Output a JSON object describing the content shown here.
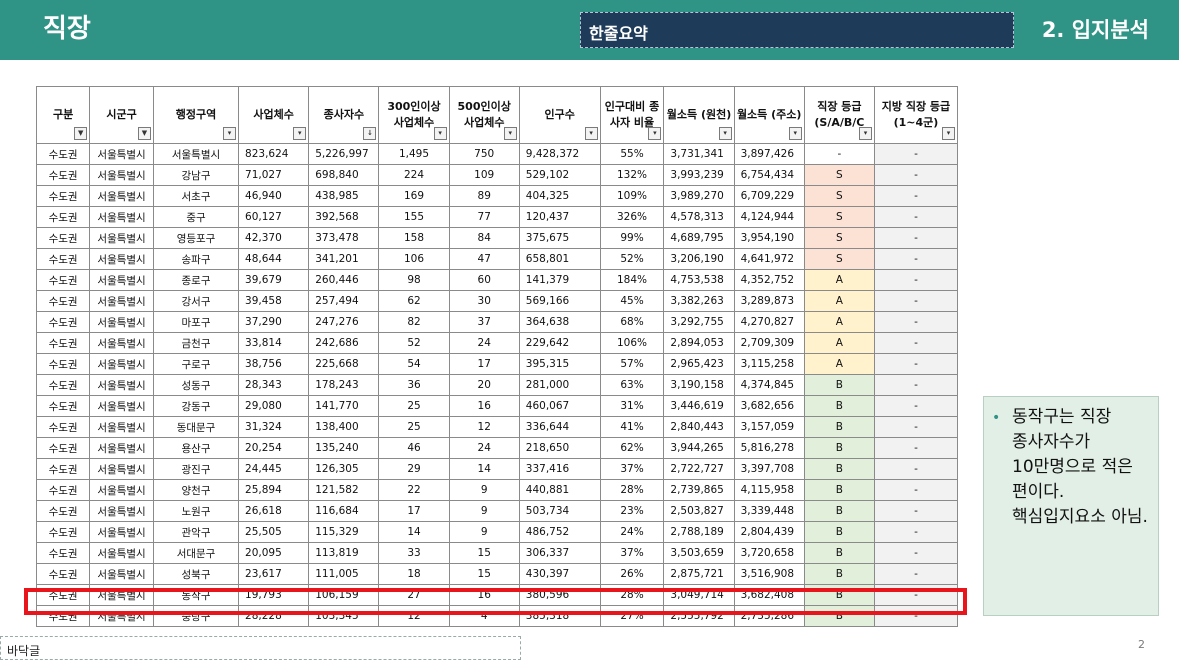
{
  "header": {
    "left_title": "직장",
    "summary_label": "한줄요약",
    "right_title": "2. 입지분석"
  },
  "table": {
    "columns": [
      {
        "label": "구분",
        "filter": "funnel"
      },
      {
        "label": "시군구",
        "filter": "funnel"
      },
      {
        "label": "행정구역",
        "filter": "dropdown"
      },
      {
        "label": "사업체수",
        "filter": "dropdown"
      },
      {
        "label": "종사자수",
        "filter": "sort-desc"
      },
      {
        "label": "300인이상 사업체수",
        "filter": "dropdown"
      },
      {
        "label": "500인이상 사업체수",
        "filter": "dropdown"
      },
      {
        "label": "인구수",
        "filter": "dropdown"
      },
      {
        "label": "인구대비 종사자 비율",
        "filter": "dropdown"
      },
      {
        "label": "월소득 (원천)",
        "filter": "dropdown"
      },
      {
        "label": "월소득 (주소)",
        "filter": "dropdown"
      },
      {
        "label": "직장 등급 (S/A/B/C",
        "filter": "dropdown"
      },
      {
        "label": "지방 직장 등급 (1~4군)",
        "filter": "dropdown"
      }
    ],
    "rows": [
      [
        "수도권",
        "서울특별시",
        "서울특별시",
        "823,624",
        "5,226,997",
        "1,495",
        "750",
        "9,428,372",
        "55%",
        "3,731,341",
        "3,897,426",
        "-",
        "-"
      ],
      [
        "수도권",
        "서울특별시",
        "강남구",
        "71,027",
        "698,840",
        "224",
        "109",
        "529,102",
        "132%",
        "3,993,239",
        "6,754,434",
        "S",
        "-"
      ],
      [
        "수도권",
        "서울특별시",
        "서초구",
        "46,940",
        "438,985",
        "169",
        "89",
        "404,325",
        "109%",
        "3,989,270",
        "6,709,229",
        "S",
        "-"
      ],
      [
        "수도권",
        "서울특별시",
        "중구",
        "60,127",
        "392,568",
        "155",
        "77",
        "120,437",
        "326%",
        "4,578,313",
        "4,124,944",
        "S",
        "-"
      ],
      [
        "수도권",
        "서울특별시",
        "영등포구",
        "42,370",
        "373,478",
        "158",
        "84",
        "375,675",
        "99%",
        "4,689,795",
        "3,954,190",
        "S",
        "-"
      ],
      [
        "수도권",
        "서울특별시",
        "송파구",
        "48,644",
        "341,201",
        "106",
        "47",
        "658,801",
        "52%",
        "3,206,190",
        "4,641,972",
        "S",
        "-"
      ],
      [
        "수도권",
        "서울특별시",
        "종로구",
        "39,679",
        "260,446",
        "98",
        "60",
        "141,379",
        "184%",
        "4,753,538",
        "4,352,752",
        "A",
        "-"
      ],
      [
        "수도권",
        "서울특별시",
        "강서구",
        "39,458",
        "257,494",
        "62",
        "30",
        "569,166",
        "45%",
        "3,382,263",
        "3,289,873",
        "A",
        "-"
      ],
      [
        "수도권",
        "서울특별시",
        "마포구",
        "37,290",
        "247,276",
        "82",
        "37",
        "364,638",
        "68%",
        "3,292,755",
        "4,270,827",
        "A",
        "-"
      ],
      [
        "수도권",
        "서울특별시",
        "금천구",
        "33,814",
        "242,686",
        "52",
        "24",
        "229,642",
        "106%",
        "2,894,053",
        "2,709,309",
        "A",
        "-"
      ],
      [
        "수도권",
        "서울특별시",
        "구로구",
        "38,756",
        "225,668",
        "54",
        "17",
        "395,315",
        "57%",
        "2,965,423",
        "3,115,258",
        "A",
        "-"
      ],
      [
        "수도권",
        "서울특별시",
        "성동구",
        "28,343",
        "178,243",
        "36",
        "20",
        "281,000",
        "63%",
        "3,190,158",
        "4,374,845",
        "B",
        "-"
      ],
      [
        "수도권",
        "서울특별시",
        "강동구",
        "29,080",
        "141,770",
        "25",
        "16",
        "460,067",
        "31%",
        "3,446,619",
        "3,682,656",
        "B",
        "-"
      ],
      [
        "수도권",
        "서울특별시",
        "동대문구",
        "31,324",
        "138,400",
        "25",
        "12",
        "336,644",
        "41%",
        "2,840,443",
        "3,157,059",
        "B",
        "-"
      ],
      [
        "수도권",
        "서울특별시",
        "용산구",
        "20,254",
        "135,240",
        "46",
        "24",
        "218,650",
        "62%",
        "3,944,265",
        "5,816,278",
        "B",
        "-"
      ],
      [
        "수도권",
        "서울특별시",
        "광진구",
        "24,445",
        "126,305",
        "29",
        "14",
        "337,416",
        "37%",
        "2,722,727",
        "3,397,708",
        "B",
        "-"
      ],
      [
        "수도권",
        "서울특별시",
        "양천구",
        "25,894",
        "121,582",
        "22",
        "9",
        "440,881",
        "28%",
        "2,739,865",
        "4,115,958",
        "B",
        "-"
      ],
      [
        "수도권",
        "서울특별시",
        "노원구",
        "26,618",
        "116,684",
        "17",
        "9",
        "503,734",
        "23%",
        "2,503,827",
        "3,339,448",
        "B",
        "-"
      ],
      [
        "수도권",
        "서울특별시",
        "관악구",
        "25,505",
        "115,329",
        "14",
        "9",
        "486,752",
        "24%",
        "2,788,189",
        "2,804,439",
        "B",
        "-"
      ],
      [
        "수도권",
        "서울특별시",
        "서대문구",
        "20,095",
        "113,819",
        "33",
        "15",
        "306,337",
        "37%",
        "3,503,659",
        "3,720,658",
        "B",
        "-"
      ],
      [
        "수도권",
        "서울특별시",
        "성북구",
        "23,617",
        "111,005",
        "18",
        "15",
        "430,397",
        "26%",
        "2,875,721",
        "3,516,908",
        "B",
        "-"
      ],
      [
        "수도권",
        "서울특별시",
        "동작구",
        "19,793",
        "106,159",
        "27",
        "16",
        "380,596",
        "28%",
        "3,049,714",
        "3,682,408",
        "B",
        "-"
      ],
      [
        "수도권",
        "서울특별시",
        "중랑구",
        "28,228",
        "103,345",
        "12",
        "4",
        "385,318",
        "27%",
        "2,555,792",
        "2,735,286",
        "B",
        "-"
      ]
    ],
    "highlighted_row": "동작구"
  },
  "note": {
    "text": "동작구는 직장 종사자수가 10만명으로 적은 편이다. 핵심입지요소 아님."
  },
  "footer": {
    "text": "바닥글",
    "page_number": "2"
  },
  "colors": {
    "header_bg": "#2f9385",
    "summary_bg": "#1f3b5a",
    "grade_s": "#fbe2d5",
    "grade_a": "#fff2cc",
    "grade_b": "#e2efda",
    "highlight_border": "#e8151c",
    "note_bg": "#e2efe7"
  }
}
